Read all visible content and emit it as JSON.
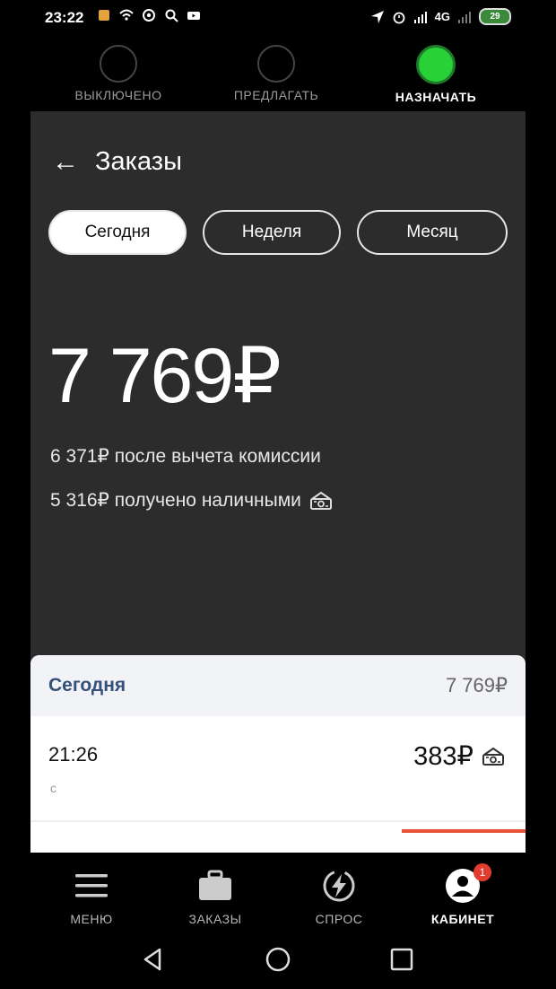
{
  "status_bar": {
    "time": "23:22",
    "network": "4G",
    "battery": "29"
  },
  "modes": [
    {
      "label": "ВЫКЛЮЧЕНО",
      "active": false
    },
    {
      "label": "ПРЕДЛАГАТЬ",
      "active": false
    },
    {
      "label": "НАЗНАЧАТЬ",
      "active": true
    }
  ],
  "header": {
    "back_icon": "arrow-left-icon",
    "title": "Заказы"
  },
  "period_tabs": [
    {
      "label": "Сегодня",
      "selected": true
    },
    {
      "label": "Неделя",
      "selected": false
    },
    {
      "label": "Месяц",
      "selected": false
    }
  ],
  "summary": {
    "total": "7 769₽",
    "after_commission": "6 371₽ после вычета комиссии",
    "cash_received": "5 316₽ получено наличными",
    "cash_icon": "cash-icon"
  },
  "orders_card": {
    "day_label": "Сегодня",
    "day_total": "7 769₽",
    "orders": [
      {
        "time": "21:26",
        "subtitle": "с",
        "price": "383₽",
        "payment_icon": "cash-icon"
      }
    ]
  },
  "bottom_nav": [
    {
      "label": "МЕНЮ",
      "icon": "menu-icon",
      "active": false
    },
    {
      "label": "ЗАКАЗЫ",
      "icon": "briefcase-icon",
      "active": false
    },
    {
      "label": "СПРОС",
      "icon": "lightning-icon",
      "active": false
    },
    {
      "label": "КАБИНЕТ",
      "icon": "profile-icon",
      "active": true,
      "badge": "1"
    }
  ],
  "colors": {
    "panel_bg": "#2c2c2c",
    "active_mode": "#27d136",
    "day_label": "#35507a",
    "badge": "#e23c2f"
  }
}
